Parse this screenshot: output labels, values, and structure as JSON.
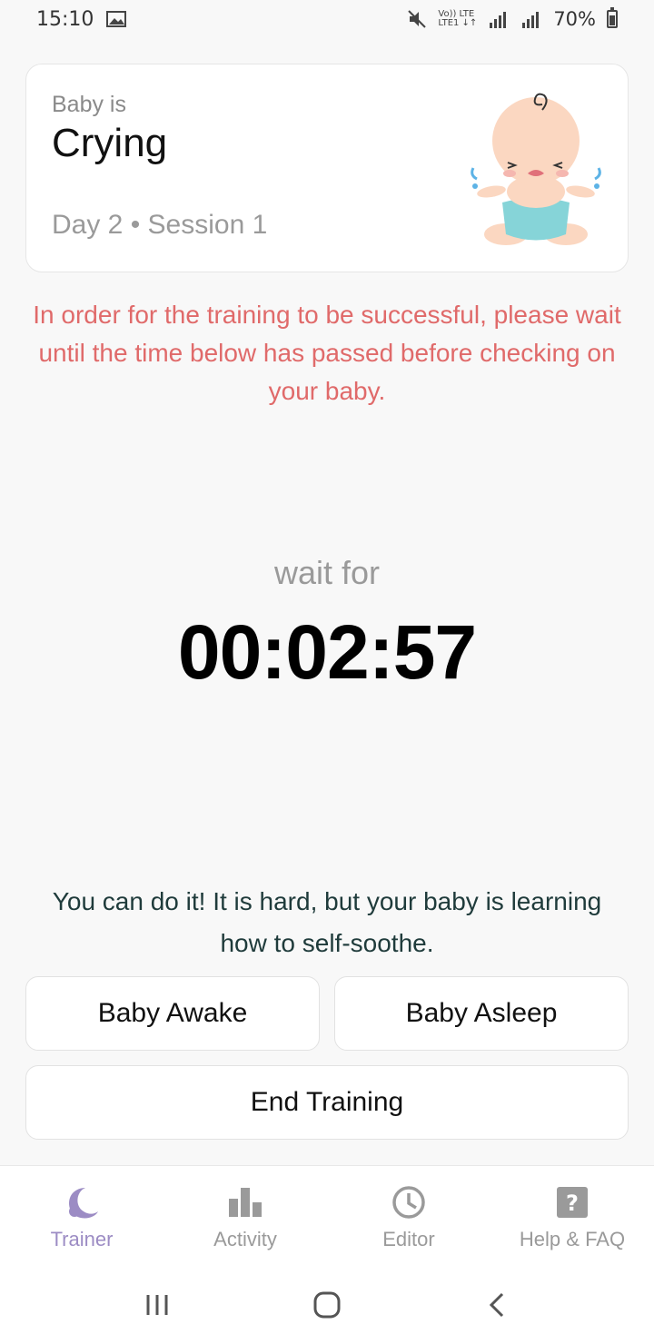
{
  "status_bar": {
    "time": "15:10",
    "network_top": "Vo)) LTE",
    "network_bottom": "LTE1 ↓↑",
    "battery": "70%"
  },
  "card": {
    "subtitle": "Baby is",
    "state": "Crying",
    "session": "Day 2 • Session 1"
  },
  "warning": "In order for the training to be successful, please wait until the time below has passed before checking on your baby.",
  "timer": {
    "label": "wait for",
    "value": "00:02:57"
  },
  "encouragement": "You can do it! It is hard, but your baby is learning how to self-soothe.",
  "buttons": {
    "awake": "Baby Awake",
    "asleep": "Baby Asleep",
    "end": "End Training"
  },
  "bottom_nav": {
    "items": [
      {
        "label": "Trainer",
        "icon": "moon-icon",
        "active": true
      },
      {
        "label": "Activity",
        "icon": "bar-chart-icon",
        "active": false
      },
      {
        "label": "Editor",
        "icon": "clock-icon",
        "active": false
      },
      {
        "label": "Help & FAQ",
        "icon": "help-icon",
        "active": false
      }
    ]
  },
  "colors": {
    "accent": "#9c8cc4",
    "warning": "#e06a6a",
    "muted": "#9a9a9a"
  }
}
